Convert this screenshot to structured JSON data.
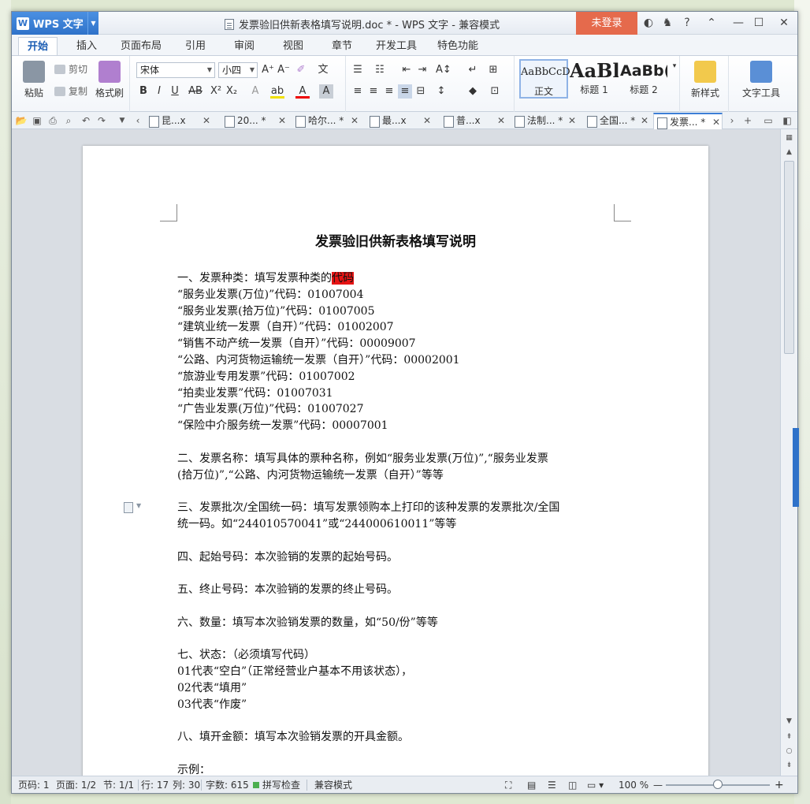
{
  "titlebar": {
    "app_name": "WPS 文字",
    "logo_letter": "W",
    "window_title": "发票验旧供新表格填写说明.doc * - WPS 文字 - 兼容模式",
    "login_label": "未登录"
  },
  "ribbon_tabs": [
    "开始",
    "插入",
    "页面布局",
    "引用",
    "审阅",
    "视图",
    "章节",
    "开发工具",
    "特色功能"
  ],
  "ribbon": {
    "paste": "粘贴",
    "cut": "剪切",
    "copy": "复制",
    "format_painter": "格式刷",
    "font_name": "宋体",
    "font_size": "小四",
    "styles": [
      {
        "preview": "AaBbCcD",
        "label": "正文"
      },
      {
        "preview": "AaBl",
        "label": "标题 1"
      },
      {
        "preview": "AaBb(",
        "label": "标题 2"
      }
    ],
    "new_style": "新样式",
    "text_tools": "文字工具"
  },
  "doc_tabs": [
    "昆...x",
    "20... *",
    "哈尔... *",
    "最...x",
    "普...x",
    "法制... *",
    "全国... *",
    "发票... *"
  ],
  "document": {
    "title": "发票验旧供新表格填写说明",
    "lines": [
      "一、发票种类：填写发票种类的",
      "“服务业发票(万位)”代码：01007004",
      "“服务业发票(拾万位)”代码：01007005",
      "“建筑业统一发票（自开）”代码：01002007",
      "“销售不动产统一发票（自开）”代码：00009007",
      "“公路、内河货物运输统一发票（自开）”代码：00002001",
      "“旅游业专用发票”代码：01007002",
      "“拍卖业发票”代码：01007031",
      "“广告业发票(万位)”代码：01007027",
      "“保险中介服务统一发票”代码：00007001",
      "",
      "二、发票名称：填写具体的票种名称，例如“服务业发票(万位)”,“服务业发票",
      "(拾万位)”,“公路、内河货物运输统一发票（自开）”等等",
      "",
      "三、发票批次/全国统一码：填写发票领购本上打印的该种发票的发票批次/全国",
      "统一码。如“244010570041”或“244000610011”等等",
      "",
      "四、起始号码：本次验销的发票的起始号码。",
      "",
      "五、终止号码：本次验销的发票的终止号码。",
      "",
      "六、数量：填写本次验销发票的数量，如“50/份”等等",
      "",
      "七、状态：（必须填写代码）",
      "01代表“空白”（正常经营业户基本不用该状态），",
      "02代表“填用”",
      "03代表“作废”",
      "",
      "八、填开金额：填写本次验销发票的开具金额。",
      "",
      "示例："
    ],
    "highlight_text": "代码"
  },
  "status": {
    "page_no": "页码: 1",
    "pages": "页面: 1/2",
    "section": "节: 1/1",
    "row": "行: 17",
    "col": "列: 30",
    "word_count": "字数: 615",
    "spell_check": "拼写检查",
    "mode": "兼容模式",
    "zoom": "100 %"
  },
  "colors": {
    "accent": "#2f72c9",
    "login": "#e56a4c",
    "highlight": "#e61414"
  }
}
